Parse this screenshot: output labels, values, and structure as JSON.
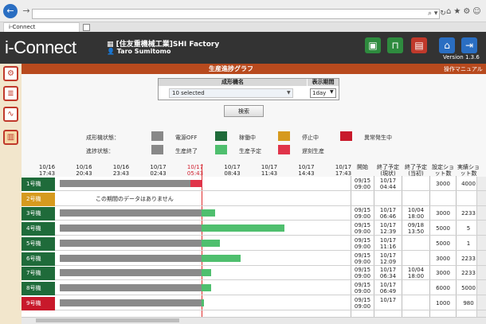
{
  "browser": {
    "tab_label": "i-Connect",
    "url": "",
    "search_placeholder": ""
  },
  "app": {
    "logo": "i-Connect",
    "company": "[住友重機械工業]SHI Factory",
    "user": "Taro Sumitomo",
    "version": "Version 1.3.6",
    "page_title": "生産進捗グラフ",
    "manual": "操作マニュアル"
  },
  "filter": {
    "header_machine": "成形機名",
    "header_unit": "表示期間",
    "machine_value": "10 selected",
    "unit_value": "1day",
    "search_label": "検索"
  },
  "legend": {
    "machine_label": "成形機状態：",
    "progress_label": "進捗状態：",
    "machine_items": [
      {
        "label": "電源OFF",
        "color": "#888888"
      },
      {
        "label": "稼働中",
        "color": "#1f6b3a"
      },
      {
        "label": "停止中",
        "color": "#d69a1e"
      },
      {
        "label": "異常発生中",
        "color": "#c8192b"
      }
    ],
    "progress_items": [
      {
        "label": "生産終了",
        "color": "#888888"
      },
      {
        "label": "生産予定",
        "color": "#4fbf6e"
      },
      {
        "label": "遅刻生産",
        "color": "#e0344a"
      }
    ]
  },
  "timeline": [
    "10/16 17:43",
    "10/16 20:43",
    "10/16 23:43",
    "10/17 02:43",
    "10/17 05:43",
    "10/17 08:43",
    "10/17 11:43",
    "10/17 14:43",
    "10/17 17:43"
  ],
  "columns": [
    "開始",
    "終了予定(現状)",
    "終了予定(当初)",
    "設定ショット数",
    "実績ショット数"
  ],
  "rows": [
    {
      "name": "1号機",
      "status_color": "#1f6b3a",
      "start": "09/15 09:00",
      "end_now": "10/17 04:44",
      "end_orig": "",
      "set": "3000",
      "actual": "4000"
    },
    {
      "name": "2号機",
      "status_color": "#d69a1e",
      "note": "この期間のデータはありません",
      "start": "",
      "end_now": "",
      "end_orig": "",
      "set": "",
      "actual": ""
    },
    {
      "name": "3号機",
      "status_color": "#1f6b3a",
      "start": "09/15 09:00",
      "end_now": "10/17 06:46",
      "end_orig": "10/04 18:00",
      "set": "3000",
      "actual": "2233"
    },
    {
      "name": "4号機",
      "status_color": "#1f6b3a",
      "start": "09/15 09:00",
      "end_now": "10/17 12:39",
      "end_orig": "09/18 13:50",
      "set": "5000",
      "actual": "5"
    },
    {
      "name": "5号機",
      "status_color": "#1f6b3a",
      "start": "09/15 09:00",
      "end_now": "10/17 11:16",
      "end_orig": "",
      "set": "5000",
      "actual": "1"
    },
    {
      "name": "6号機",
      "status_color": "#1f6b3a",
      "start": "09/15 09:00",
      "end_now": "10/17 12:09",
      "end_orig": "",
      "set": "3000",
      "actual": "2233"
    },
    {
      "name": "7号機",
      "status_color": "#1f6b3a",
      "start": "09/15 09:00",
      "end_now": "10/17 06:34",
      "end_orig": "10/04 18:00",
      "set": "3000",
      "actual": "2233"
    },
    {
      "name": "8号機",
      "status_color": "#1f6b3a",
      "start": "09/15 09:00",
      "end_now": "10/17 06:49",
      "end_orig": "",
      "set": "6000",
      "actual": "5000"
    },
    {
      "name": "9号機",
      "status_color": "#c8192b",
      "start": "09/15 09:00",
      "end_now": "10/17",
      "end_orig": "",
      "set": "1000",
      "actual": "980"
    }
  ]
}
